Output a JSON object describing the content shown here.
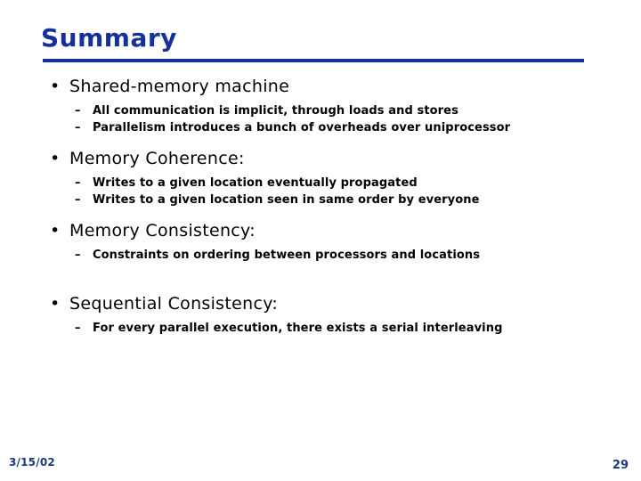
{
  "slide": {
    "title": "Summary",
    "accent_color": "#14309b",
    "body_text_color": "#000000",
    "background_color": "#ffffff",
    "footer_color": "#1b3a7a",
    "bullet_marker": "•",
    "sub_bullet_marker": "–"
  },
  "content": {
    "groups": [
      {
        "heading": "Shared-memory machine",
        "subs": [
          "All communication is implicit, through loads and stores",
          "Parallelism introduces a bunch of overheads over uniprocessor"
        ]
      },
      {
        "heading": "Memory Coherence:",
        "subs": [
          "Writes to a given location eventually propagated",
          "Writes to a given location seen in same order by everyone"
        ]
      },
      {
        "heading": "Memory Consistency:",
        "subs": [
          "Constraints on ordering between processors and locations"
        ]
      },
      {
        "heading": "Sequential Consistency:",
        "subs": [
          "For every parallel execution, there exists a serial interleaving"
        ]
      }
    ]
  },
  "footer": {
    "date": "3/15/02",
    "page_number": "29"
  }
}
